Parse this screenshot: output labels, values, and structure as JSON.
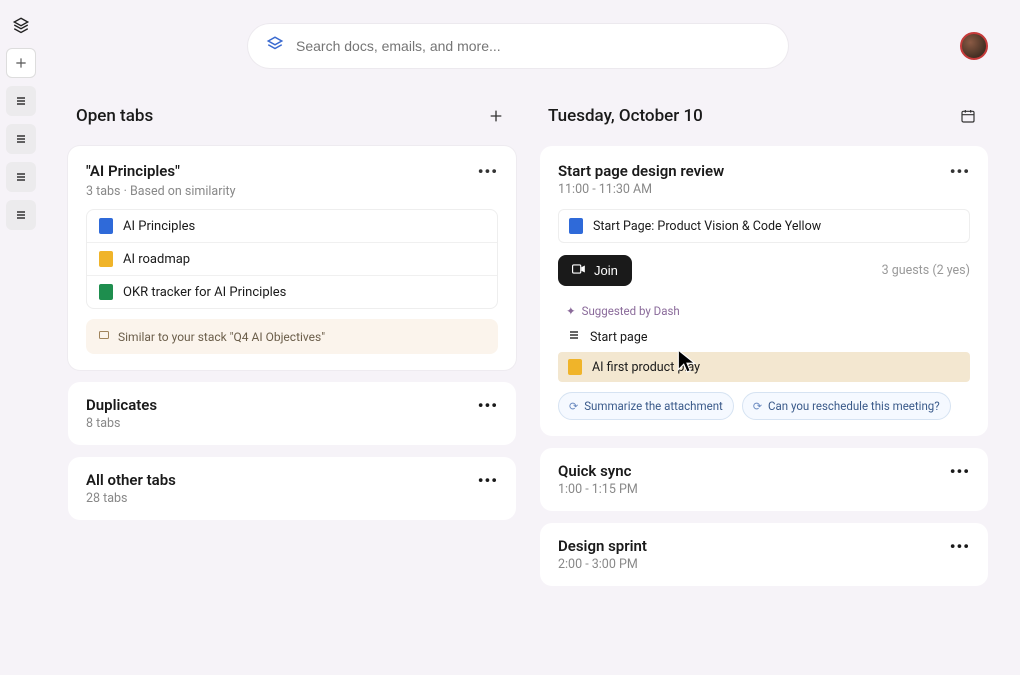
{
  "search": {
    "placeholder": "Search docs, emails, and more..."
  },
  "left": {
    "header": "Open tabs",
    "group1": {
      "title": "\"AI Principles\"",
      "subtitle": "3 tabs · Based on similarity",
      "items": [
        {
          "label": "AI Principles",
          "color": "blue"
        },
        {
          "label": "AI roadmap",
          "color": "yellow"
        },
        {
          "label": "OKR tracker for AI Principles",
          "color": "green"
        }
      ],
      "suggestion": "Similar to your stack \"Q4 AI Objectives\""
    },
    "group2": {
      "title": "Duplicates",
      "subtitle": "8 tabs"
    },
    "group3": {
      "title": "All other tabs",
      "subtitle": "28 tabs"
    }
  },
  "right": {
    "header": "Tuesday, October 10",
    "event1": {
      "title": "Start page design review",
      "time": "11:00 - 11:30 AM",
      "attachment": "Start Page: Product Vision & Code Yellow",
      "join": "Join",
      "guests": "3 guests (2 yes)",
      "suggested_by": "Suggested by Dash",
      "suggestions": [
        {
          "label": "Start page",
          "hl": false
        },
        {
          "label": "AI first product play",
          "hl": true
        }
      ],
      "chips": [
        "Summarize the attachment",
        "Can you reschedule this meeting?"
      ]
    },
    "event2": {
      "title": "Quick sync",
      "time": "1:00 - 1:15 PM"
    },
    "event3": {
      "title": "Design sprint",
      "time": "2:00 - 3:00 PM"
    }
  }
}
